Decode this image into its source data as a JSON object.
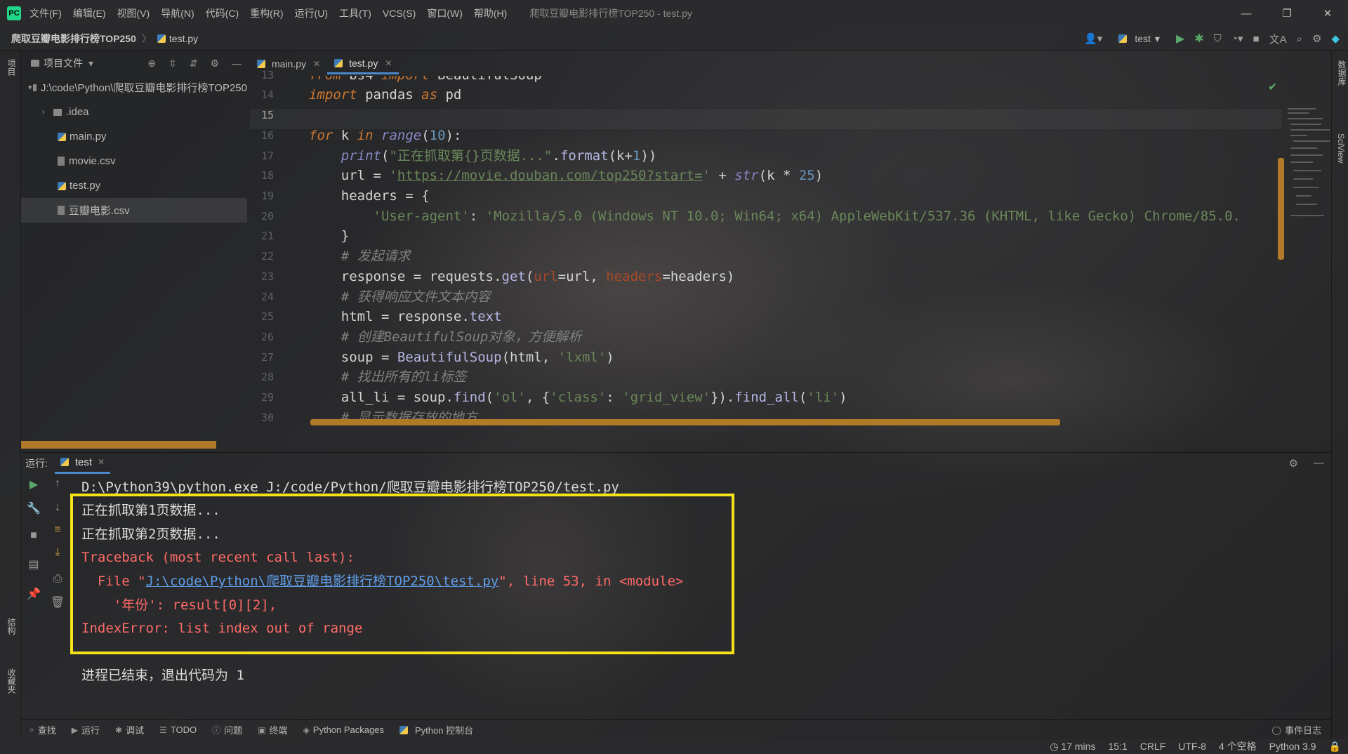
{
  "app": {
    "logo": "PC",
    "window_title": "爬取豆瓣电影排行榜TOP250 - test.py"
  },
  "menu": [
    "文件(F)",
    "编辑(E)",
    "视图(V)",
    "导航(N)",
    "代码(C)",
    "重构(R)",
    "运行(U)",
    "工具(T)",
    "VCS(S)",
    "窗口(W)",
    "帮助(H)"
  ],
  "window_controls": {
    "minimize": "—",
    "restore": "❐",
    "close": "✕"
  },
  "breadcrumb": {
    "project": "爬取豆瓣电影排行榜TOP250",
    "file": "test.py"
  },
  "toolbar": {
    "run_config": "test"
  },
  "left_strip": {
    "project_label": "项目",
    "structure_label": "结构",
    "favorites_label": "收藏夹"
  },
  "right_strip": {
    "db_label": "数据库",
    "sciview_label": "SciView"
  },
  "project_panel": {
    "title": "项目文件",
    "root": "J:\\code\\Python\\爬取豆瓣电影排行榜TOP250",
    "items": [
      {
        "name": ".idea",
        "kind": "folder"
      },
      {
        "name": "main.py",
        "kind": "python"
      },
      {
        "name": "movie.csv",
        "kind": "csv"
      },
      {
        "name": "test.py",
        "kind": "python"
      },
      {
        "name": "豆瓣电影.csv",
        "kind": "csv",
        "selected": true
      }
    ]
  },
  "editor_tabs": [
    {
      "label": "main.py",
      "active": false
    },
    {
      "label": "test.py",
      "active": true
    }
  ],
  "editor": {
    "line_numbers": [
      "13",
      "14",
      "15",
      "16",
      "17",
      "18",
      "19",
      "20",
      "21",
      "22",
      "23",
      "24",
      "25",
      "26",
      "27",
      "28",
      "29",
      "30"
    ],
    "current_line": "15"
  },
  "run_panel": {
    "label": "运行:",
    "tab": "test",
    "command": "D:\\Python39\\python.exe J:/code/Python/爬取豆瓣电影排行榜TOP250/test.py",
    "out1": "正在抓取第1页数据...",
    "out2": "正在抓取第2页数据...",
    "traceback": "Traceback (most recent call last):",
    "file_prefix": "  File \"",
    "file_link": "J:\\code\\Python\\爬取豆瓣电影排行榜TOP250\\test.py",
    "file_suffix": "\", line 53, in <module>",
    "code_line": "    '年份': result[0][2],",
    "error": "IndexError: list index out of range",
    "exit": "进程已结束，退出代码为 1"
  },
  "tool_windows": [
    "查找",
    "运行",
    "调试",
    "TODO",
    "问题",
    "终端",
    "Python Packages",
    "Python 控制台"
  ],
  "event_log": "事件日志",
  "status_bar": {
    "time": "17 mins",
    "position": "15:1",
    "line_sep": "CRLF",
    "encoding": "UTF-8",
    "indent": "4 个空格",
    "interpreter": "Python 3.9"
  },
  "colors": {
    "accent": "#4a88c7",
    "highlight_box": "#f3e21a",
    "error": "#ff6b68",
    "scrollbar": "#b07a28",
    "run_green": "#59a869"
  }
}
